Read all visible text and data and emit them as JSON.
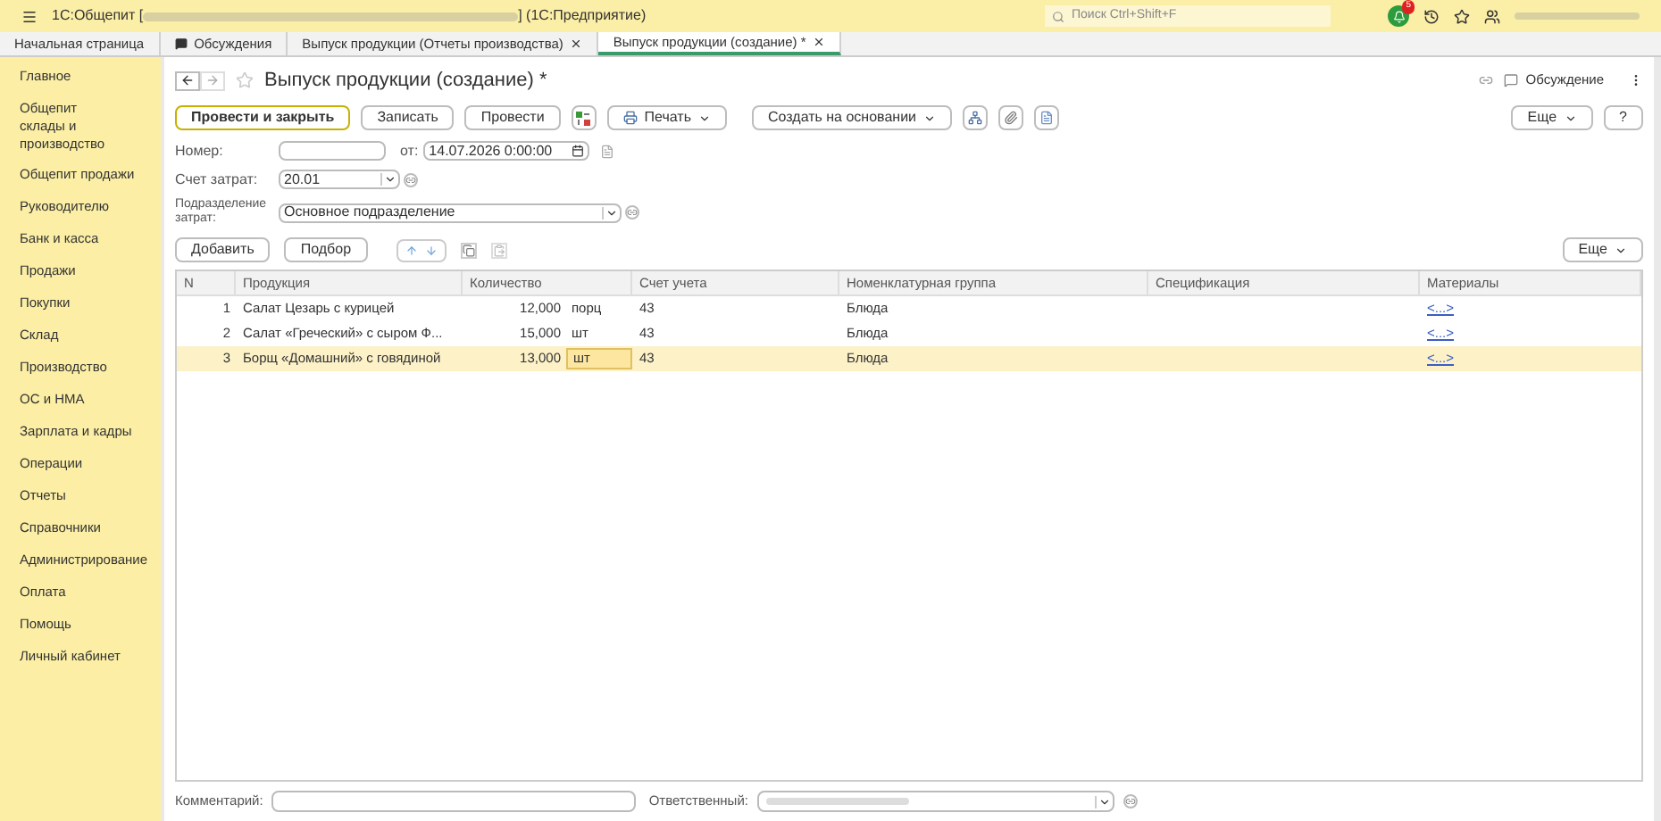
{
  "window": {
    "title_prefix": "1С:Общепит [",
    "title_suffix": "] (1С:Предприятие)",
    "search": {
      "placeholder": "Поиск Ctrl+Shift+F"
    },
    "notifications": "5"
  },
  "tabs": [
    {
      "label": "Начальная страница",
      "selected": false,
      "closable": false,
      "kind": "page"
    },
    {
      "label": "Обсуждения",
      "selected": false,
      "closable": false,
      "kind": "discussion"
    },
    {
      "label": "Выпуск продукции (Отчеты производства)",
      "selected": false,
      "closable": true,
      "kind": "page"
    },
    {
      "label": "Выпуск продукции (создание) *",
      "selected": true,
      "closable": true,
      "kind": "page"
    }
  ],
  "sidebar": {
    "items": [
      {
        "label": "Главное"
      },
      {
        "label": "Общепит\nсклады и производство"
      },
      {
        "label": "Общепит продажи"
      },
      {
        "label": "Руководителю"
      },
      {
        "label": "Банк и касса"
      },
      {
        "label": "Продажи"
      },
      {
        "label": "Покупки"
      },
      {
        "label": "Склад"
      },
      {
        "label": "Производство"
      },
      {
        "label": "ОС и НМА"
      },
      {
        "label": "Зарплата и кадры"
      },
      {
        "label": "Операции"
      },
      {
        "label": "Отчеты"
      },
      {
        "label": "Справочники"
      },
      {
        "label": "Администрирование"
      },
      {
        "label": "Оплата"
      },
      {
        "label": "Помощь"
      },
      {
        "label": "Личный кабинет"
      }
    ]
  },
  "form": {
    "title": "Выпуск продукции (создание) *",
    "discussion": "Обсуждение",
    "toolbar": [
      {
        "label": "Провести и закрыть",
        "kind": "primary"
      },
      {
        "label": "Записать",
        "kind": "button"
      },
      {
        "label": "Провести",
        "kind": "button"
      },
      {
        "kind": "icon"
      },
      {
        "label": "Печать",
        "kind": "print"
      },
      {
        "label": "Создать на основании",
        "kind": "menu"
      },
      {
        "kind": "icon"
      },
      {
        "kind": "icon"
      },
      {
        "kind": "icon"
      }
    ],
    "more": "Еще",
    "help": "?",
    "number": {
      "label": "Номер:"
    },
    "date": {
      "label": "от:",
      "value": "14.07.2026  0:00:00"
    },
    "account": {
      "label": "Счет затрат:",
      "value": "20.01"
    },
    "department": {
      "label": "Подразделение затрат:",
      "value": "Основное подразделение"
    },
    "table_toolbar": {
      "add": "Добавить",
      "pick": "Подбор",
      "more": "Еще"
    },
    "table": {
      "columns": [
        "N",
        "Продукция",
        "Количество",
        "Счет учета",
        "Номенклатурная группа",
        "Спецификация",
        "Материалы"
      ],
      "rows": [
        {
          "n": "1",
          "product": "Салат Цезарь с курицей",
          "qty": "12,000",
          "unit": "порц",
          "account": "43",
          "group": "Блюда",
          "materials": "<...>",
          "selected": false
        },
        {
          "n": "2",
          "product": "Салат «Греческий» с сыром Ф...",
          "qty": "15,000",
          "unit": "шт",
          "account": "43",
          "group": "Блюда",
          "materials": "<...>",
          "selected": false
        },
        {
          "n": "3",
          "product": "Борщ «Домашний» с говядиной",
          "qty": "13,000",
          "unit": "шт",
          "account": "43",
          "group": "Блюда",
          "materials": "<...>",
          "selected": true
        }
      ]
    },
    "comment": {
      "label": "Комментарий:"
    },
    "responsible": {
      "label": "Ответственный:"
    }
  }
}
